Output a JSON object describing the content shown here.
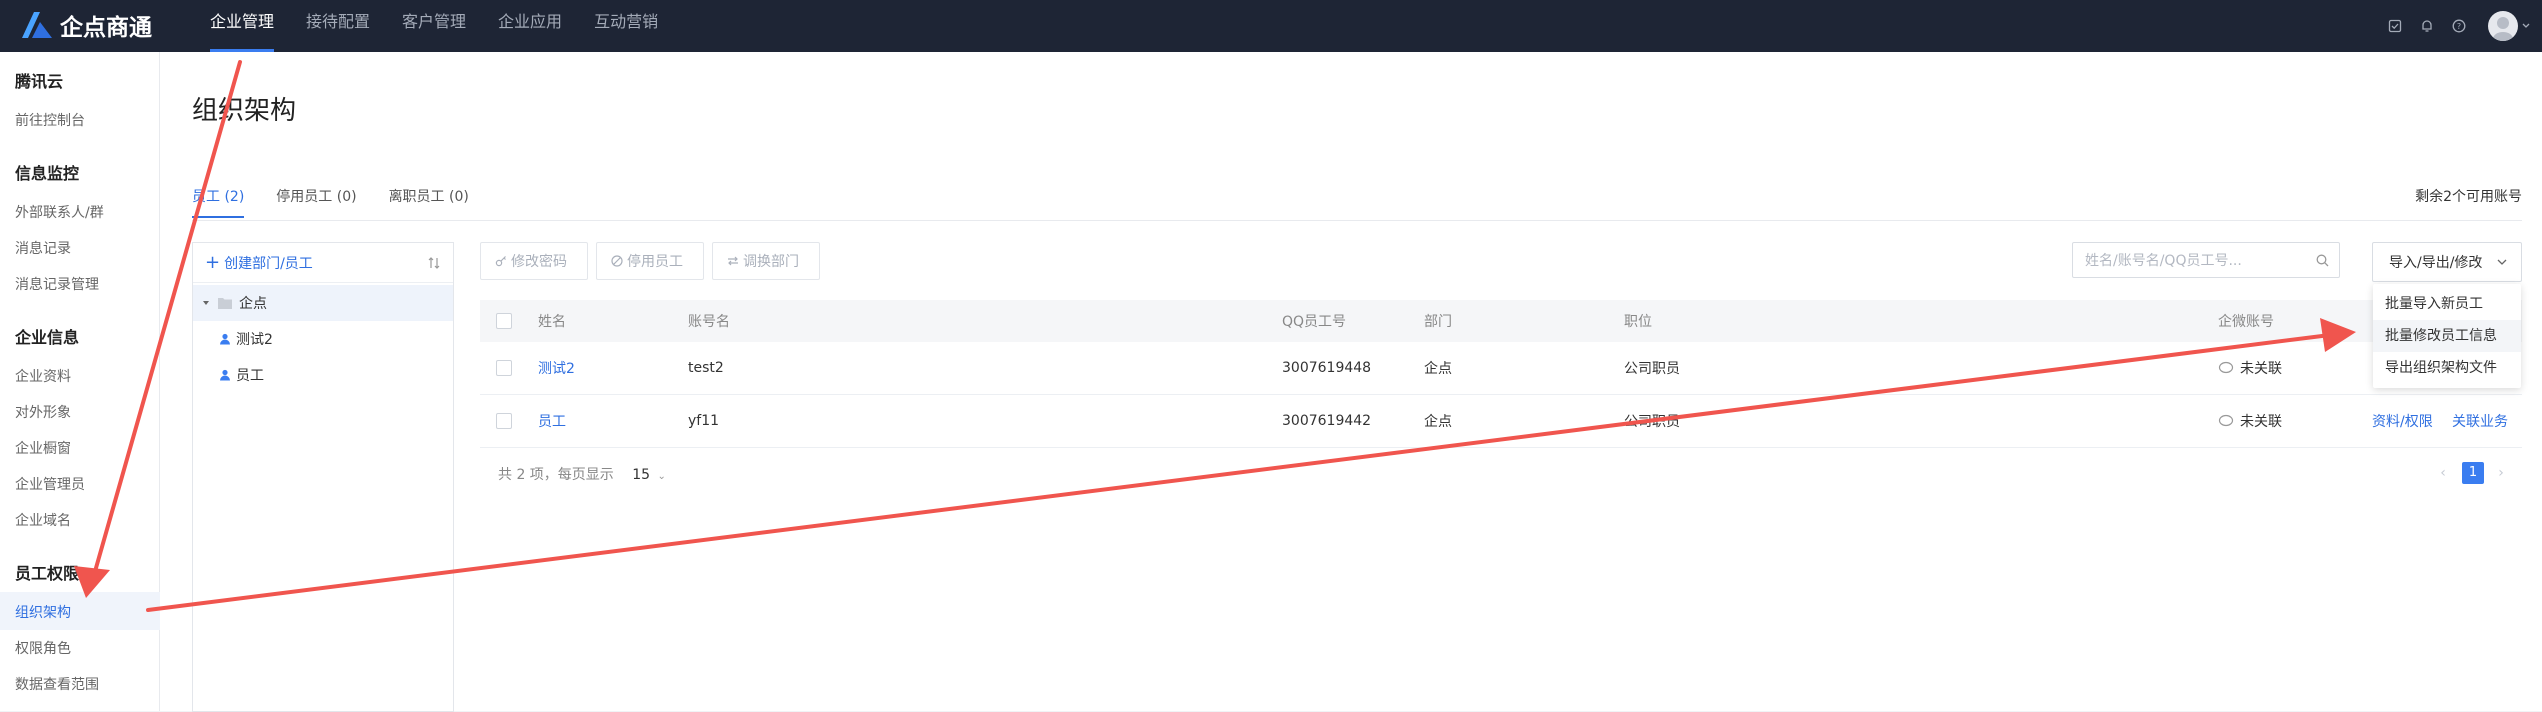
{
  "app": {
    "brand": "企点商通"
  },
  "nav": {
    "items": [
      "企业管理",
      "接待配置",
      "客户管理",
      "企业应用",
      "互动营销"
    ],
    "active_index": 0
  },
  "sidebar": {
    "groups": [
      {
        "title": "腾讯云",
        "items": [
          "前往控制台"
        ]
      },
      {
        "title": "信息监控",
        "items": [
          "外部联系人/群",
          "消息记录",
          "消息记录管理"
        ]
      },
      {
        "title": "企业信息",
        "items": [
          "企业资料",
          "对外形象",
          "企业橱窗",
          "企业管理员",
          "企业域名"
        ]
      },
      {
        "title": "员工权限",
        "items": [
          "组织架构",
          "权限角色",
          "数据查看范围"
        ]
      }
    ],
    "active_item": "组织架构"
  },
  "page": {
    "title": "组织架构",
    "tabs": [
      "员工 (2)",
      "停用员工 (0)",
      "离职员工 (0)"
    ],
    "remaining": "剩余2个可用账号"
  },
  "tree": {
    "create_label": "创建部门/员工",
    "root": "企点",
    "members": [
      "测试2",
      "员工"
    ]
  },
  "toolbar": {
    "edit_password": "修改密码",
    "disable_staff": "停用员工",
    "transfer_dept": "调换部门",
    "search_placeholder": "姓名/账号名/QQ员工号...",
    "dropdown_label": "导入/导出/修改",
    "dropdown_items": [
      "批量导入新员工",
      "批量修改员工信息",
      "导出组织架构文件"
    ]
  },
  "table": {
    "headers": [
      "姓名",
      "账号名",
      "QQ员工号",
      "部门",
      "职位",
      "企微账号"
    ],
    "rows": [
      {
        "name": "测试2",
        "account": "test2",
        "qq": "3007619448",
        "dept": "企点",
        "position": "公司职员",
        "wework": "未关联",
        "actions": []
      },
      {
        "name": "员工",
        "account": "yf11",
        "qq": "3007619442",
        "dept": "企点",
        "position": "公司职员",
        "wework": "未关联",
        "actions": [
          "资料/权限",
          "关联业务"
        ]
      }
    ]
  },
  "pagination": {
    "total_text": "共 2 项，每页显示",
    "page_size": "15",
    "current_page": "1"
  },
  "colors": {
    "accent": "#3a7df0",
    "topbar": "#1e2535",
    "annotation_arrow": "#f0554e"
  }
}
